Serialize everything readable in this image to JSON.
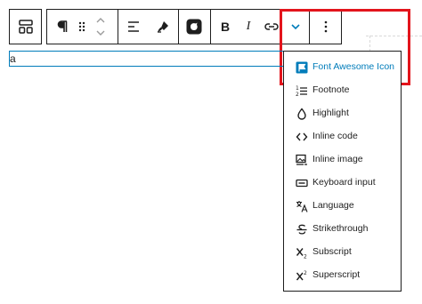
{
  "editor": {
    "block_text": "a"
  },
  "toolbar": {
    "buttons": [
      {
        "name": "block-type",
        "icon": "block-layout-icon"
      },
      {
        "name": "paragraph",
        "icon": "pilcrow-icon"
      },
      {
        "name": "drag",
        "icon": "drag-handle-icon"
      },
      {
        "name": "move",
        "icon": "chevron-up-down-icon"
      },
      {
        "name": "align",
        "icon": "align-left-icon"
      },
      {
        "name": "highlighter",
        "icon": "highlighter-icon"
      },
      {
        "name": "plugin",
        "icon": "plugin-logo-icon"
      },
      {
        "name": "bold",
        "label": "B"
      },
      {
        "name": "italic",
        "label": "I"
      },
      {
        "name": "link",
        "icon": "link-icon"
      },
      {
        "name": "more-rich-text",
        "icon": "chevron-down-icon"
      },
      {
        "name": "options",
        "icon": "more-vertical-icon"
      }
    ],
    "bold_label": "B",
    "italic_label": "I"
  },
  "dropdown": {
    "items": [
      {
        "label": "Font Awesome Icon",
        "icon": "flag-icon",
        "highlighted": true
      },
      {
        "label": "Footnote",
        "icon": "footnote-icon"
      },
      {
        "label": "Highlight",
        "icon": "droplet-icon"
      },
      {
        "label": "Inline code",
        "icon": "code-icon"
      },
      {
        "label": "Inline image",
        "icon": "image-icon"
      },
      {
        "label": "Keyboard input",
        "icon": "keyboard-icon"
      },
      {
        "label": "Language",
        "icon": "language-icon"
      },
      {
        "label": "Strikethrough",
        "icon": "strikethrough-icon"
      },
      {
        "label": "Subscript",
        "icon": "subscript-icon"
      },
      {
        "label": "Superscript",
        "icon": "superscript-icon"
      }
    ]
  },
  "colors": {
    "accent": "#007cba",
    "annotation_red": "#e3141c",
    "border": "#1e1e1e"
  }
}
